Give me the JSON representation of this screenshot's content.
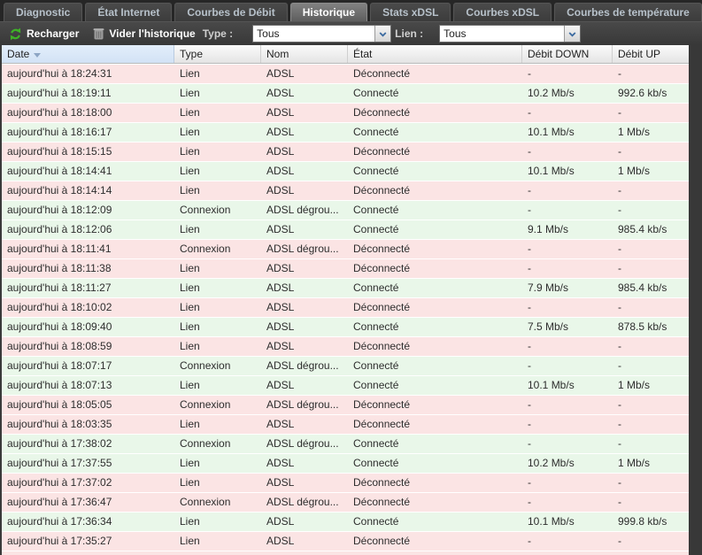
{
  "tabs": [
    {
      "label": "Diagnostic",
      "active": false
    },
    {
      "label": "État Internet",
      "active": false
    },
    {
      "label": "Courbes de Débit",
      "active": false
    },
    {
      "label": "Historique",
      "active": true
    },
    {
      "label": "Stats xDSL",
      "active": false
    },
    {
      "label": "Courbes xDSL",
      "active": false
    },
    {
      "label": "Courbes de température",
      "active": false
    }
  ],
  "toolbar": {
    "refresh_label": "Recharger",
    "clear_label": "Vider l'historique",
    "type_label": "Type :",
    "type_value": "Tous",
    "link_label": "Lien :",
    "link_value": "Tous",
    "icons": {
      "refresh": "refresh-arrows-icon",
      "clear": "trash-icon",
      "combo": "chevron-down-icon"
    }
  },
  "colors": {
    "row_connected_bg": "#e9f7e9",
    "row_disconnected_bg": "#fbe4e4",
    "refresh_green": "#3fb227",
    "sorted_header_bg": "#d9e7f8",
    "toolbar_bg": "#414141",
    "tabbar_bg": "#262626"
  },
  "table": {
    "columns": [
      {
        "label": "Date",
        "sort": "desc"
      },
      {
        "label": "Type",
        "sort": null
      },
      {
        "label": "Nom",
        "sort": null
      },
      {
        "label": "État",
        "sort": null
      },
      {
        "label": "Débit DOWN",
        "sort": null
      },
      {
        "label": "Débit UP",
        "sort": null
      }
    ],
    "rows": [
      {
        "date": "aujourd'hui à 18:24:31",
        "type": "Lien",
        "name": "ADSL",
        "state": "Déconnecté",
        "down": "-",
        "up": "-",
        "status": "disconnected"
      },
      {
        "date": "aujourd'hui à 18:19:11",
        "type": "Lien",
        "name": "ADSL",
        "state": "Connecté",
        "down": "10.2 Mb/s",
        "up": "992.6 kb/s",
        "status": "connected"
      },
      {
        "date": "aujourd'hui à 18:18:00",
        "type": "Lien",
        "name": "ADSL",
        "state": "Déconnecté",
        "down": "-",
        "up": "-",
        "status": "disconnected"
      },
      {
        "date": "aujourd'hui à 18:16:17",
        "type": "Lien",
        "name": "ADSL",
        "state": "Connecté",
        "down": "10.1 Mb/s",
        "up": "1 Mb/s",
        "status": "connected"
      },
      {
        "date": "aujourd'hui à 18:15:15",
        "type": "Lien",
        "name": "ADSL",
        "state": "Déconnecté",
        "down": "-",
        "up": "-",
        "status": "disconnected"
      },
      {
        "date": "aujourd'hui à 18:14:41",
        "type": "Lien",
        "name": "ADSL",
        "state": "Connecté",
        "down": "10.1 Mb/s",
        "up": "1 Mb/s",
        "status": "connected"
      },
      {
        "date": "aujourd'hui à 18:14:14",
        "type": "Lien",
        "name": "ADSL",
        "state": "Déconnecté",
        "down": "-",
        "up": "-",
        "status": "disconnected"
      },
      {
        "date": "aujourd'hui à 18:12:09",
        "type": "Connexion",
        "name": "ADSL dégrou...",
        "state": "Connecté",
        "down": "-",
        "up": "-",
        "status": "connected"
      },
      {
        "date": "aujourd'hui à 18:12:06",
        "type": "Lien",
        "name": "ADSL",
        "state": "Connecté",
        "down": "9.1 Mb/s",
        "up": "985.4 kb/s",
        "status": "connected"
      },
      {
        "date": "aujourd'hui à 18:11:41",
        "type": "Connexion",
        "name": "ADSL dégrou...",
        "state": "Déconnecté",
        "down": "-",
        "up": "-",
        "status": "disconnected"
      },
      {
        "date": "aujourd'hui à 18:11:38",
        "type": "Lien",
        "name": "ADSL",
        "state": "Déconnecté",
        "down": "-",
        "up": "-",
        "status": "disconnected"
      },
      {
        "date": "aujourd'hui à 18:11:27",
        "type": "Lien",
        "name": "ADSL",
        "state": "Connecté",
        "down": "7.9 Mb/s",
        "up": "985.4 kb/s",
        "status": "connected"
      },
      {
        "date": "aujourd'hui à 18:10:02",
        "type": "Lien",
        "name": "ADSL",
        "state": "Déconnecté",
        "down": "-",
        "up": "-",
        "status": "disconnected"
      },
      {
        "date": "aujourd'hui à 18:09:40",
        "type": "Lien",
        "name": "ADSL",
        "state": "Connecté",
        "down": "7.5 Mb/s",
        "up": "878.5 kb/s",
        "status": "connected"
      },
      {
        "date": "aujourd'hui à 18:08:59",
        "type": "Lien",
        "name": "ADSL",
        "state": "Déconnecté",
        "down": "-",
        "up": "-",
        "status": "disconnected"
      },
      {
        "date": "aujourd'hui à 18:07:17",
        "type": "Connexion",
        "name": "ADSL dégrou...",
        "state": "Connecté",
        "down": "-",
        "up": "-",
        "status": "connected"
      },
      {
        "date": "aujourd'hui à 18:07:13",
        "type": "Lien",
        "name": "ADSL",
        "state": "Connecté",
        "down": "10.1 Mb/s",
        "up": "1 Mb/s",
        "status": "connected"
      },
      {
        "date": "aujourd'hui à 18:05:05",
        "type": "Connexion",
        "name": "ADSL dégrou...",
        "state": "Déconnecté",
        "down": "-",
        "up": "-",
        "status": "disconnected"
      },
      {
        "date": "aujourd'hui à 18:03:35",
        "type": "Lien",
        "name": "ADSL",
        "state": "Déconnecté",
        "down": "-",
        "up": "-",
        "status": "disconnected"
      },
      {
        "date": "aujourd'hui à 17:38:02",
        "type": "Connexion",
        "name": "ADSL dégrou...",
        "state": "Connecté",
        "down": "-",
        "up": "-",
        "status": "connected"
      },
      {
        "date": "aujourd'hui à 17:37:55",
        "type": "Lien",
        "name": "ADSL",
        "state": "Connecté",
        "down": "10.2 Mb/s",
        "up": "1 Mb/s",
        "status": "connected"
      },
      {
        "date": "aujourd'hui à 17:37:02",
        "type": "Lien",
        "name": "ADSL",
        "state": "Déconnecté",
        "down": "-",
        "up": "-",
        "status": "disconnected"
      },
      {
        "date": "aujourd'hui à 17:36:47",
        "type": "Connexion",
        "name": "ADSL dégrou...",
        "state": "Déconnecté",
        "down": "-",
        "up": "-",
        "status": "disconnected"
      },
      {
        "date": "aujourd'hui à 17:36:34",
        "type": "Lien",
        "name": "ADSL",
        "state": "Connecté",
        "down": "10.1 Mb/s",
        "up": "999.8 kb/s",
        "status": "connected"
      },
      {
        "date": "aujourd'hui à 17:35:27",
        "type": "Lien",
        "name": "ADSL",
        "state": "Déconnecté",
        "down": "-",
        "up": "-",
        "status": "disconnected"
      }
    ]
  }
}
